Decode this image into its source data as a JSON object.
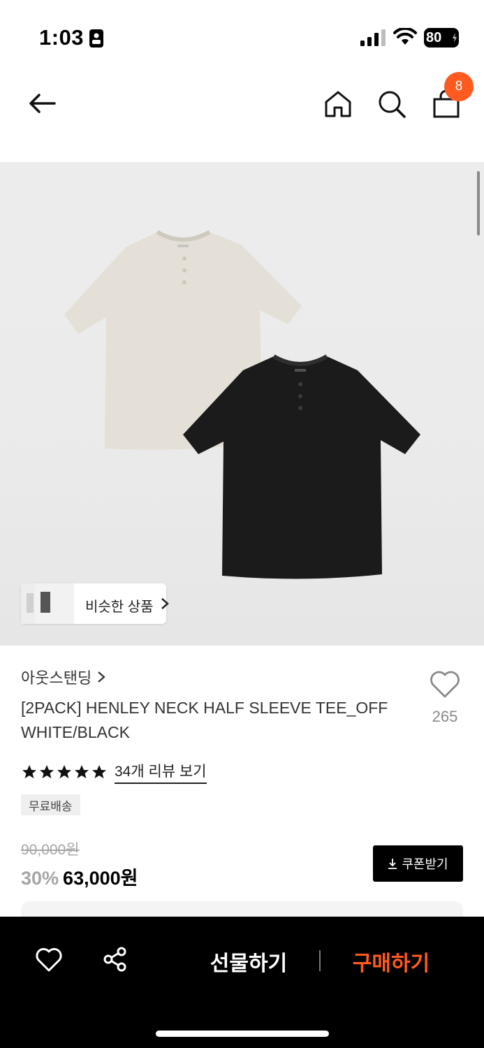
{
  "status_bar": {
    "time": "1:03",
    "battery": "80"
  },
  "nav": {
    "cart_count": "8"
  },
  "gallery": {
    "similar_label": "비슷한 상품"
  },
  "product": {
    "brand": "아웃스탠딩",
    "title": "[2PACK] HENLEY NECK HALF SLEEVE TEE_OFF WHITE/BLACK",
    "likes": "265",
    "rating_stars": 5,
    "review_link": "34개 리뷰 보기",
    "free_shipping": "무료배송",
    "original_price": "90,000원",
    "discount": "30%",
    "sale_price": "63,000원",
    "coupon_label": "쿠폰받기"
  },
  "bottom_bar": {
    "gift_label": "선물하기",
    "buy_label": "구매하기"
  },
  "colors": {
    "accent": "#ff5a1f",
    "text": "#111111",
    "muted": "#a6a6a6",
    "bar": "#000000"
  }
}
